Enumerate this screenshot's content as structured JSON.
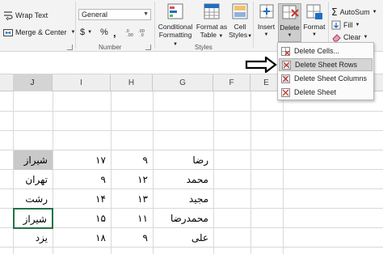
{
  "ribbon": {
    "wrap_text_label": "Wrap Text",
    "merge_center_label": "Merge & Center",
    "number_format_value": "General",
    "currency_symbol": "$",
    "percent_symbol": "%",
    "comma_symbol": ",",
    "number_group_label": "Number",
    "conditional_formatting_label": [
      "Conditional",
      "Formatting"
    ],
    "format_as_table_label": [
      "Format as",
      "Table"
    ],
    "cell_styles_label": [
      "Cell",
      "Styles"
    ],
    "styles_group_label": "Styles",
    "insert_label": "Insert",
    "delete_label": "Delete",
    "format_label": "Format",
    "autosum_label": "AutoSum",
    "fill_label": "Fill",
    "clear_label": "Clear"
  },
  "delete_menu": {
    "items": [
      {
        "label": "Delete Cells...",
        "highlighted": false
      },
      {
        "label": "Delete Sheet Rows",
        "highlighted": true
      },
      {
        "label": "Delete Sheet Columns",
        "highlighted": false
      },
      {
        "label": "Delete Sheet",
        "highlighted": false
      }
    ]
  },
  "grid": {
    "columns": [
      "J",
      "I",
      "H",
      "G",
      "F",
      "E"
    ],
    "active_column": "J",
    "rows": [
      {
        "city": "شیراز",
        "num1": "۱۷",
        "num2": "۹",
        "name": "رضا"
      },
      {
        "city": "تهران",
        "num1": "۹",
        "num2": "۱۲",
        "name": "محمد"
      },
      {
        "city": "رشت",
        "num1": "۱۴",
        "num2": "۱۳",
        "name": "مجید"
      },
      {
        "city": "شیراز",
        "num1": "۱۵",
        "num2": "۱۱",
        "name": "محمدرضا"
      },
      {
        "city": "یزد",
        "num1": "۱۸",
        "num2": "۹",
        "name": "علی"
      }
    ]
  },
  "colors": {
    "ribbon_bg": "#f3f3f3",
    "selection_green": "#217346",
    "highlight_gray": "#c9c9c9",
    "delete_red": "#c0392b"
  }
}
